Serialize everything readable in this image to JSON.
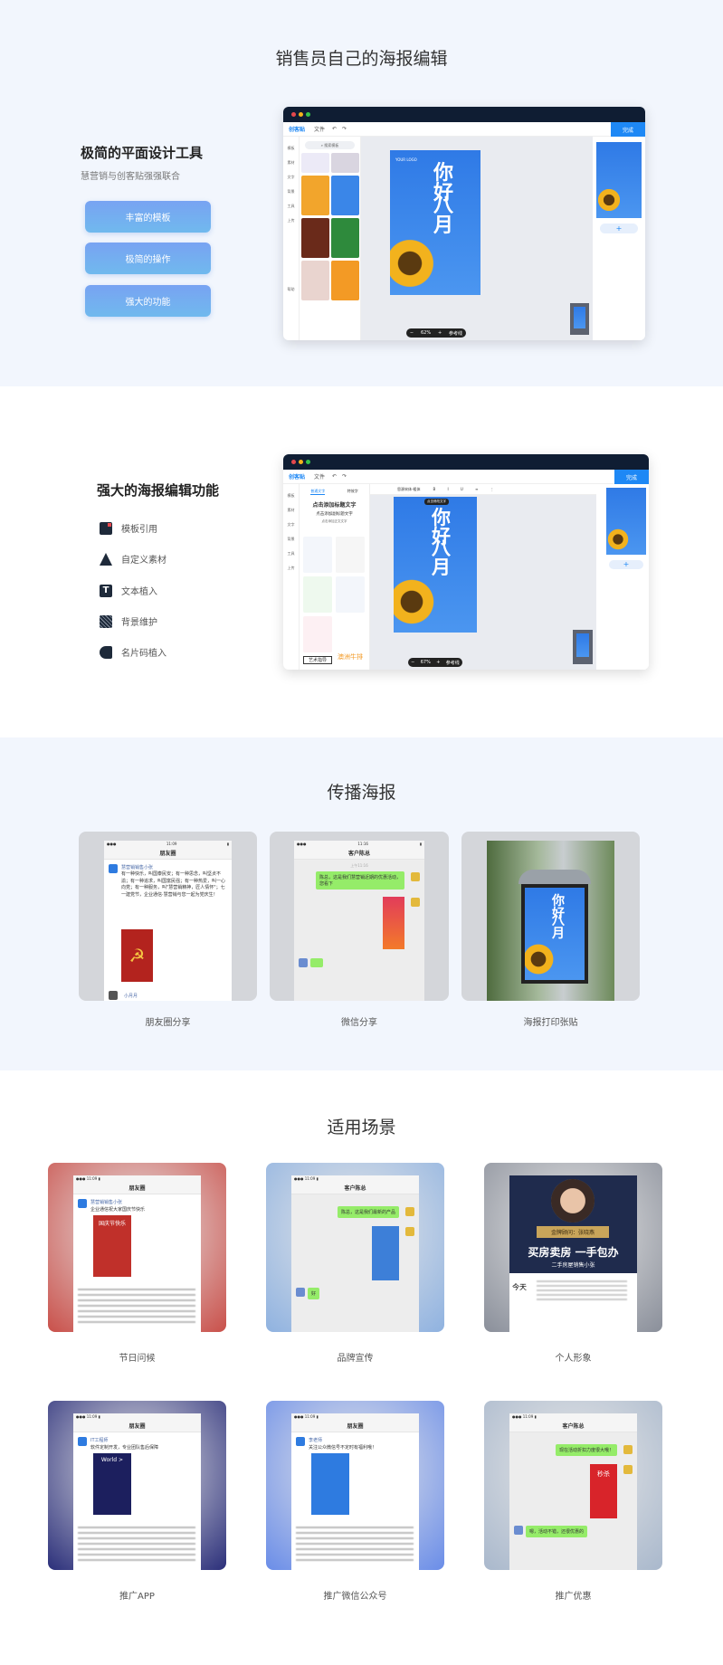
{
  "section1": {
    "title": "销售员自己的海报编辑",
    "heading": "极简的平面设计工具",
    "subtitle": "慧营销与创客贴强强联合",
    "buttons": [
      "丰富的模板",
      "极简的操作",
      "强大的功能"
    ]
  },
  "editor": {
    "logo": "创客贴",
    "file_menu": "文件",
    "done": "完成",
    "search_placeholder": "搜索模板",
    "rail": [
      "模板",
      "素材",
      "文字",
      "背景",
      "工具",
      "上传"
    ],
    "help": "帮助",
    "poster_title_1": "你好",
    "poster_title_2": "八月",
    "poster_logo": "YOUR LOGO",
    "zoom_1": "62%",
    "zoom_2": "67%",
    "ref_line": "参考线",
    "add": "+",
    "text_tabs": [
      "普通文字",
      "特效字"
    ],
    "text_samples": [
      "点击添加标题文字",
      "点击添加副标题文字",
      "点击添加正文文字"
    ],
    "font_name": "思源宋体-粗体",
    "art_label": "艺术指导",
    "steak_label": "澳洲牛排",
    "selected_label": "点击修改文字"
  },
  "section2": {
    "heading": "强大的海报编辑功能",
    "features": [
      {
        "label": "模板引用",
        "icon": "template-icon"
      },
      {
        "label": "自定义素材",
        "icon": "shape-icon"
      },
      {
        "label": "文本植入",
        "icon": "text-icon"
      },
      {
        "label": "背景维护",
        "icon": "background-icon"
      },
      {
        "label": "名片码植入",
        "icon": "card-code-icon"
      }
    ]
  },
  "section3": {
    "title": "传播海报",
    "cards": [
      {
        "caption": "朋友圈分享",
        "nav": "朋友圈",
        "user": "慧营销销售小张",
        "text": "有一种快乐，叫国泰民安；有一种思念，叫坚贞不渝；有一种追求，叫国富民强；有一种热爱，叫一心向党；有一种服务，叫\"慧营销精神，匠人情怀\"；七一建党节，企业通信·慧营销与您一起为党庆生！",
        "commenter": "小月月"
      },
      {
        "caption": "微信分享",
        "nav": "客户陈总",
        "time": "上午11:16",
        "msg": "陈总，这是我们慧营销近期的优惠活动，您看下"
      },
      {
        "caption": "海报打印张贴"
      }
    ]
  },
  "section4": {
    "title": "适用场景",
    "cards": [
      {
        "caption": "节日问候",
        "kind": "moments",
        "nav": "朋友圈",
        "user": "慧营销销售小张",
        "text": "企业通信祝大家国庆节快乐",
        "poster": "国庆节快乐",
        "bg": "#c9504a",
        "pc": "#c0302a"
      },
      {
        "caption": "品牌宣传",
        "kind": "chat",
        "nav": "客户陈总",
        "msg": "陈总，这是我们最新的产品",
        "reply": "好",
        "bg": "#8fb2e0",
        "pc": "#3d7fd8"
      },
      {
        "caption": "个人形象",
        "kind": "profile",
        "name": "金牌顾问：张晓燕",
        "slogan": "买房卖房 一手包办",
        "role": "二手房屋销售小张",
        "today": "今天",
        "bg": "#8a8f9a"
      },
      {
        "caption": "推广APP",
        "kind": "moments",
        "nav": "朋友圈",
        "user": "IT工程师",
        "text": "软件定制开发，专业团队售后保障",
        "poster": "World >",
        "bg": "#2b2f7a",
        "pc": "#1c1f5e"
      },
      {
        "caption": "推广微信公众号",
        "kind": "moments",
        "nav": "朋友圈",
        "user": "李老师",
        "text": "关注公众微信号不定时有福利哦！",
        "poster": "",
        "bg": "#6a8de8",
        "pc": "#2e7be0"
      },
      {
        "caption": "推广优惠",
        "kind": "chat",
        "nav": "客户陈总",
        "msg": "现在活动折扣力度很大哦！",
        "reply": "嗯，活动不错，还很优惠的",
        "poster": "秒杀",
        "bg": "#a9b8cc",
        "pc": "#d8242a"
      }
    ]
  },
  "colors": {
    "accent": "#1e88f5",
    "light_bg": "#f2f6fd",
    "button_start": "#78a3f2",
    "button_end": "#70b9ee",
    "dark_bar": "#0f1d33"
  }
}
